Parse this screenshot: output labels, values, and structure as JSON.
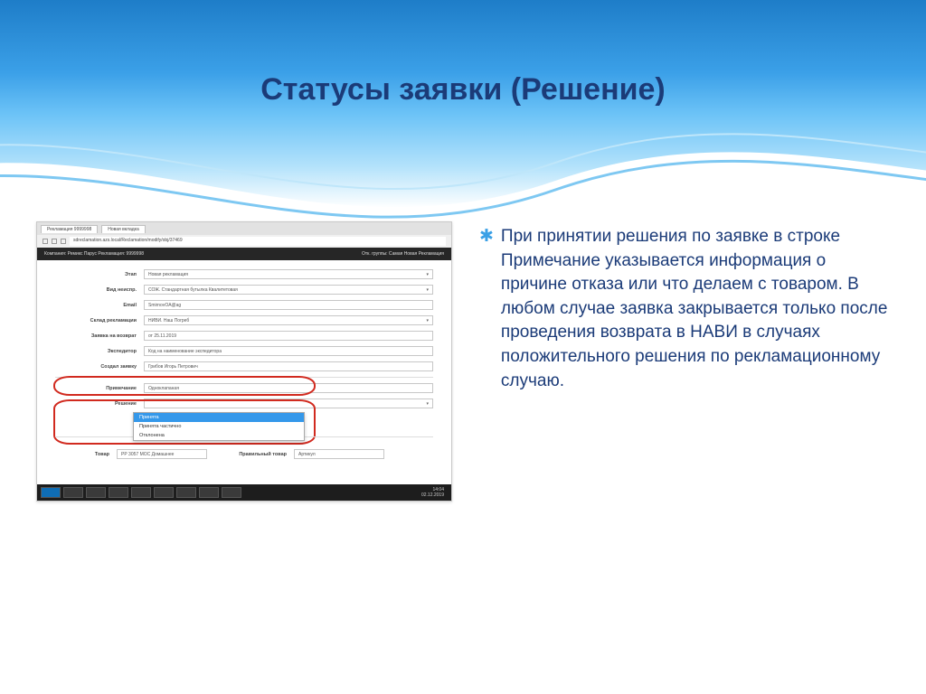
{
  "slide": {
    "title": "Статусы заявки (Решение)"
  },
  "bullet": {
    "text": "При принятии решения по заявке в строке Примечание указывается информация о причине отказа или что делаем с товаром. В любом случае заявка закрывается только после проведения возврата в НАВИ в случаях положительного решения по рекламационному случаю."
  },
  "screenshot": {
    "tabs": [
      "Рекламация 9999998",
      "Новая вкладка"
    ],
    "url": "sdreclamation.azs.local/Reclamation/modify/obj/37469",
    "headerLeft": "Компания: Ремикс Парус   Рекламация: 9999998",
    "headerRight": "Отк. группы: Самая Новая Рекламация",
    "formRows": [
      {
        "label": "Этап",
        "value": "Новая рекламация",
        "select": true
      },
      {
        "label": "Вид неиспр.",
        "value": "СОЖ. Стандартная бутылка Квалитетовая",
        "select": true
      },
      {
        "label": "Email",
        "value": "SmirnovOA@ag"
      },
      {
        "label": "Склад рекламации",
        "value": "НИВИ. Наш Погреб",
        "select": true
      },
      {
        "label": "Заявка на возврат",
        "value": "от 25.11.2019"
      },
      {
        "label": "Экспедитор",
        "value": "Код на наименование экспедитора"
      },
      {
        "label": "Создал заявку",
        "value": "Грибов Игорь Петрович"
      }
    ],
    "circledRows": [
      {
        "label": "Примечание",
        "value": "Одноклапаная"
      },
      {
        "label": "Решение",
        "value": ""
      }
    ],
    "dropdown": [
      "Принята",
      "Принята частично",
      "Отклонена"
    ],
    "bottomRow": {
      "leftLabel": "Товар",
      "leftValue": "РР 3057 МОС Домашнее",
      "rightLabel": "Правильный товар",
      "rightValue": "Артикул"
    },
    "clock": {
      "time": "14:04",
      "date": "02.12.2019"
    }
  }
}
